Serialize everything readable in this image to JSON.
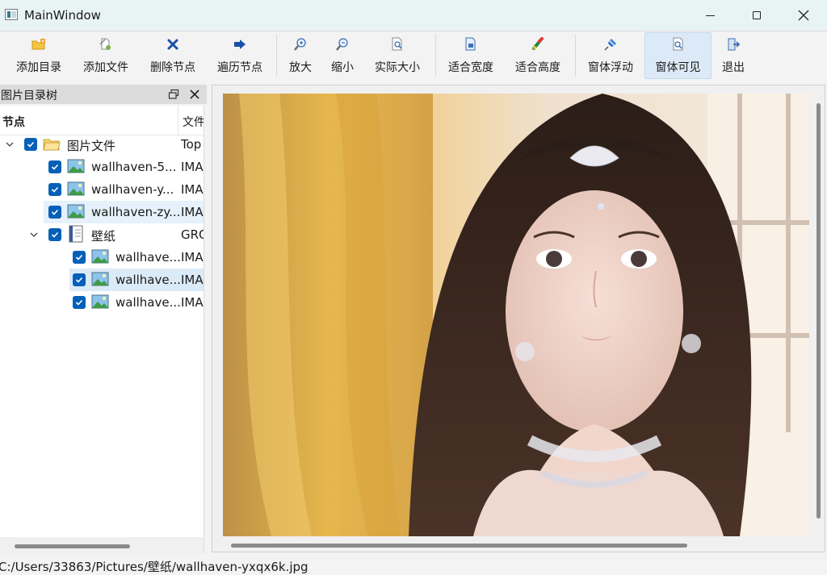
{
  "window": {
    "title": "MainWindow"
  },
  "toolbar": {
    "buttons": [
      {
        "label": "添加目录",
        "icon": "folder-add-icon"
      },
      {
        "label": "添加文件",
        "icon": "file-add-icon"
      },
      {
        "label": "删除节点",
        "icon": "delete-icon"
      },
      {
        "label": "遍历节点",
        "icon": "traverse-icon"
      },
      {
        "label": "放大",
        "icon": "zoom-in-icon"
      },
      {
        "label": "缩小",
        "icon": "zoom-out-icon"
      },
      {
        "label": "实际大小",
        "icon": "actual-size-icon"
      },
      {
        "label": "适合宽度",
        "icon": "fit-width-icon"
      },
      {
        "label": "适合高度",
        "icon": "fit-height-icon"
      },
      {
        "label": "窗体浮动",
        "icon": "pin-icon"
      },
      {
        "label": "窗体可见",
        "icon": "visible-icon",
        "active": true
      },
      {
        "label": "退出",
        "icon": "exit-icon"
      }
    ]
  },
  "dock": {
    "title": "图片目录树",
    "columns": [
      "节点",
      "文件"
    ]
  },
  "tree": {
    "rows": [
      {
        "label": "图片文件",
        "col2": "Top",
        "depth": 0,
        "expanded": true,
        "icon": "folder-icon",
        "checked": true
      },
      {
        "label": "wallhaven-5...",
        "col2": "IMA",
        "depth": 1,
        "icon": "image-icon",
        "checked": true
      },
      {
        "label": "wallhaven-y...",
        "col2": "IMA",
        "depth": 1,
        "icon": "image-icon",
        "checked": true
      },
      {
        "label": "wallhaven-zy...",
        "col2": "IMA",
        "depth": 1,
        "icon": "image-icon",
        "checked": true,
        "hover": true
      },
      {
        "label": "壁纸",
        "col2": "GRO",
        "depth": 1,
        "expanded": true,
        "icon": "group-icon",
        "checked": true
      },
      {
        "label": "wallhave...",
        "col2": "IMA",
        "depth": 2,
        "icon": "image-icon",
        "checked": true
      },
      {
        "label": "wallhave...",
        "col2": "IMA",
        "depth": 2,
        "icon": "image-icon",
        "checked": true,
        "selected": true
      },
      {
        "label": "wallhave...",
        "col2": "IMA",
        "depth": 2,
        "icon": "image-icon",
        "checked": true
      }
    ]
  },
  "status": {
    "path": "C:/Users/33863/Pictures/壁纸/wallhaven-yxqx6k.jpg"
  }
}
